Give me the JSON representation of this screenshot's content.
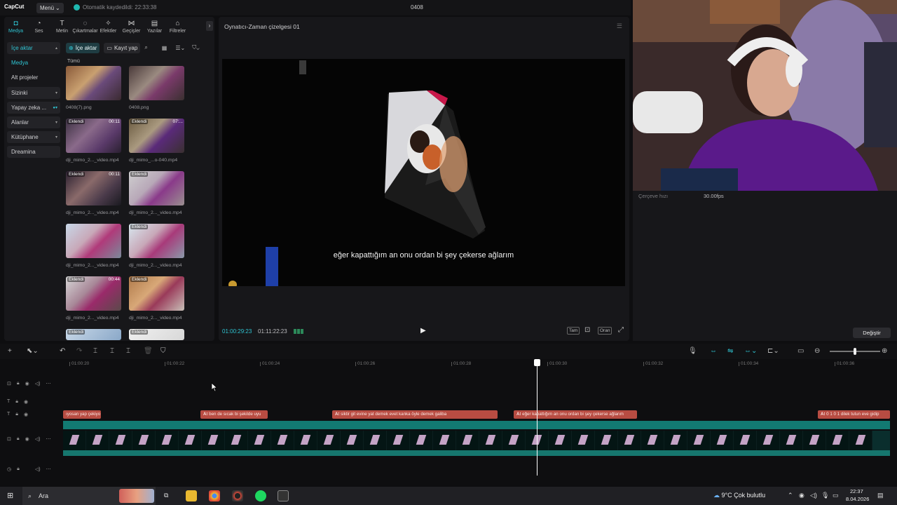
{
  "titlebar": {
    "logo": "CapCut",
    "menu": "Menü",
    "autosave": "Otomatik kaydedildi: 22:33:38",
    "project": "0408"
  },
  "tabs": [
    {
      "label": "Medya",
      "icon": "◘"
    },
    {
      "label": "Ses",
      "icon": "◔"
    },
    {
      "label": "Metin",
      "icon": "T"
    },
    {
      "label": "Çıkartmalar",
      "icon": "◌"
    },
    {
      "label": "Efektler",
      "icon": "✧"
    },
    {
      "label": "Geçişler",
      "icon": "⋈"
    },
    {
      "label": "Yazılar",
      "icon": "▤"
    },
    {
      "label": "Filtreler",
      "icon": "⌂"
    }
  ],
  "sidenav": [
    {
      "label": "İçe aktar"
    },
    {
      "label": "Medya"
    },
    {
      "label": "Alt projeler"
    },
    {
      "label": "Sizinki"
    },
    {
      "label": "Yapay zeka ..."
    },
    {
      "label": "Alanlar"
    },
    {
      "label": "Kütüphane"
    },
    {
      "label": "Dreamina"
    }
  ],
  "media_toolbar": {
    "import": "İçe aktar",
    "record": "Kayıt yap",
    "filter_all": "Tümü"
  },
  "media": [
    {
      "name": "0408(7).png",
      "badge": "",
      "dur": ""
    },
    {
      "name": "0408.png",
      "badge": "",
      "dur": ""
    },
    {
      "name": "dji_mimo_2..._video.mp4",
      "badge": "Eklendi",
      "dur": "00:11"
    },
    {
      "name": "dji_mimo_...o-040.mp4",
      "badge": "Eklendi",
      "dur": "07:..."
    },
    {
      "name": "dji_mimo_2..._video.mp4",
      "badge": "Eklendi",
      "dur": "00:11"
    },
    {
      "name": "dji_mimo_2..._video.mp4",
      "badge": "Eklendi",
      "dur": ""
    },
    {
      "name": "dji_mimo_2..._video.mp4",
      "badge": "",
      "dur": ""
    },
    {
      "name": "dji_mimo_2..._video.mp4",
      "badge": "Eklendi",
      "dur": ""
    },
    {
      "name": "dji_mimo_2..._video.mp4",
      "badge": "Eklendi",
      "dur": "00:44"
    },
    {
      "name": "dji_mimo_2..._video.mp4",
      "badge": "Eklendi",
      "dur": ""
    },
    {
      "name": "",
      "badge": "Eklendi",
      "dur": ""
    },
    {
      "name": "",
      "badge": "Eklendi",
      "dur": ""
    }
  ],
  "player": {
    "title": "Oynatıcı-Zaman çizelgesi 01",
    "subtitle": "eğer kapattığım an onu ordan bi şey çekerse ağlarım",
    "current": "01:00:29:23",
    "total": "01:11:22:23",
    "btn_full": "Tam",
    "btn_ratio": "Oran"
  },
  "details": {
    "fps_label": "Çerçeve hızı",
    "fps_value": "30.00fps",
    "modify": "Değiştir"
  },
  "timeline": {
    "ticks": [
      "01:00:20",
      "01:00:22",
      "01:00:24",
      "01:00:26",
      "01:00:28",
      "01:00:30",
      "01:00:32",
      "01:00:34",
      "01:00:36"
    ],
    "subtitles": [
      "ıyosan yap çekiyo",
      "ben de sıcak bi şekilde uyu",
      "siktir git evine yat demek evet kanka öyle demek galiba",
      "eğer kapattığım an onu ordan bi şey çekerse ağlarım",
      "0 1 0 1 dilek tutun eve gidip"
    ]
  },
  "taskbar": {
    "search": "Ara",
    "weather": "9°C  Çok bulutlu",
    "time": "22:37",
    "date": "8.04.2026"
  }
}
